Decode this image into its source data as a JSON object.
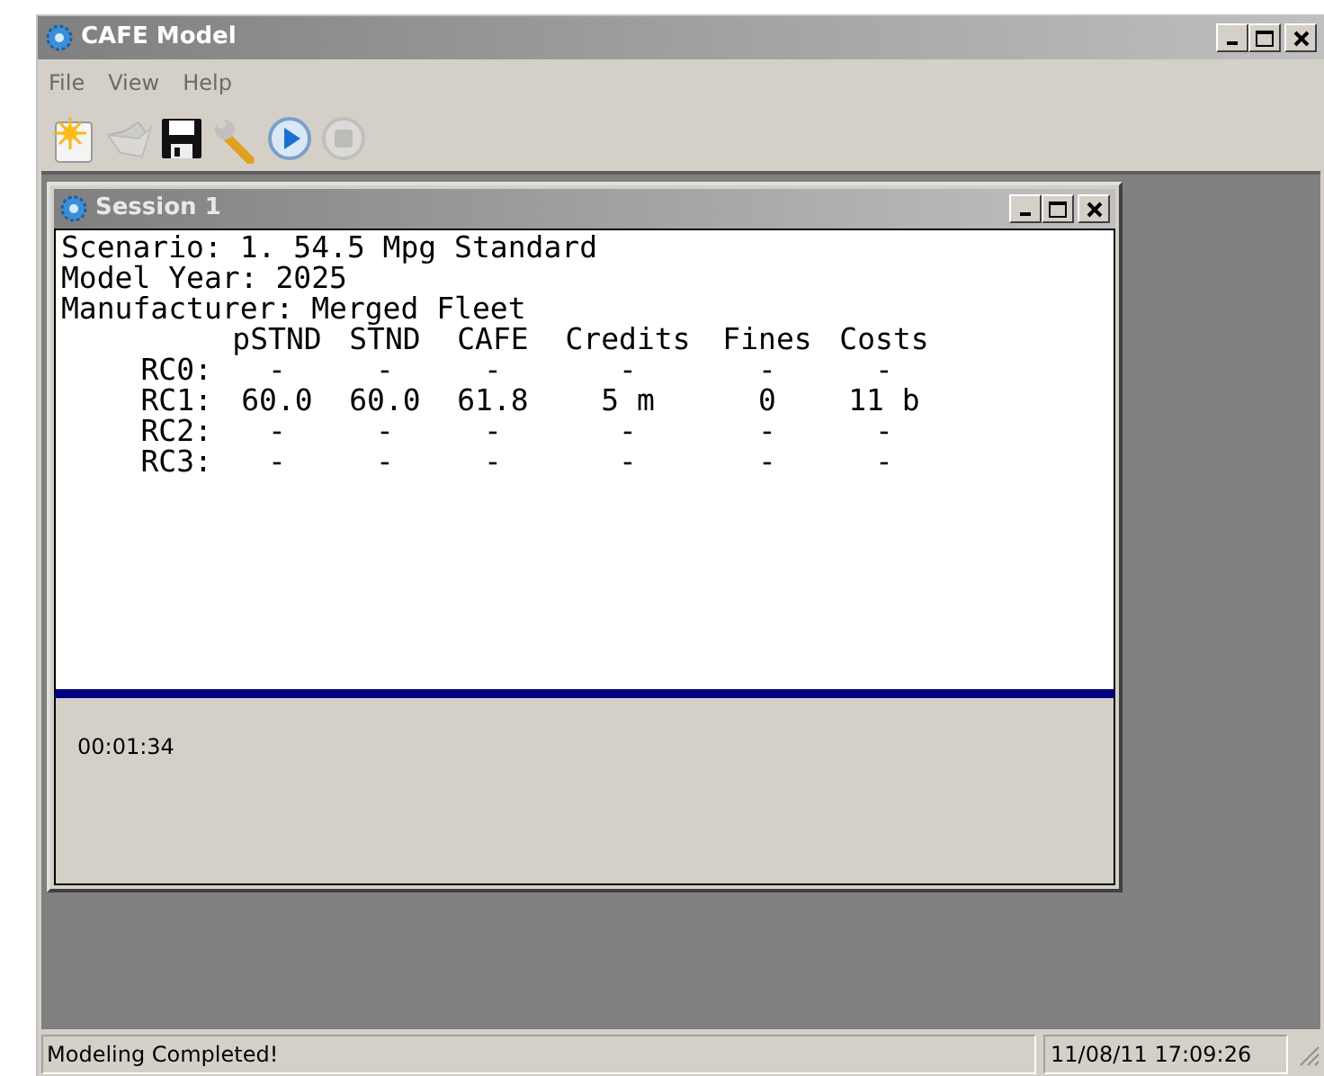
{
  "window": {
    "title": "CAFE Model"
  },
  "menu": [
    "File",
    "View",
    "Help"
  ],
  "toolbar": [
    {
      "kind": "new",
      "disabled": false
    },
    {
      "kind": "open",
      "disabled": true
    },
    {
      "kind": "save",
      "disabled": false
    },
    {
      "kind": "settings",
      "disabled": false
    },
    {
      "kind": "run",
      "disabled": false
    },
    {
      "kind": "stop",
      "disabled": true
    }
  ],
  "session": {
    "title": "Session 1",
    "lines": [
      "Scenario: 1. 54.5 Mpg Standard",
      "Model Year: 2025",
      "Manufacturer: Merged Fleet"
    ],
    "table": {
      "columns": [
        "",
        "pSTND",
        "STND",
        "CAFE",
        "Credits",
        "Fines",
        "Costs"
      ],
      "rows": [
        [
          "RC0:",
          "-",
          "-",
          "-",
          "-",
          "-",
          "-"
        ],
        [
          "RC1:",
          "60.0",
          "60.0",
          "61.8",
          "5 m",
          "0",
          "11 b"
        ],
        [
          "RC2:",
          "-",
          "-",
          "-",
          "-",
          "-",
          "-"
        ],
        [
          "RC3:",
          "-",
          "-",
          "-",
          "-",
          "-",
          "-"
        ]
      ]
    },
    "elapsed": "00:01:34"
  },
  "status_bar": {
    "message": "Modeling Completed!",
    "timestamp": "11/08/11 17:09:26"
  }
}
